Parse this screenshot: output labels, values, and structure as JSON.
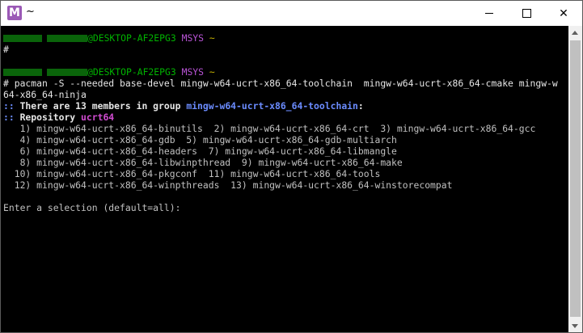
{
  "window": {
    "title": "~",
    "icon_letter": "M",
    "minimize_icon": "minimize-icon",
    "maximize_icon": "maximize-icon",
    "close_icon": "close-icon",
    "close_glyph": "✕"
  },
  "colors": {
    "prompt_green": "#00b300",
    "msys_purple": "#b954d6",
    "tilde_yellow": "#c8b400",
    "group_blue": "#6b8cff",
    "repo_magenta": "#d24cd2"
  },
  "terminal": {
    "prompt1": {
      "host": "@DESKTOP-AF2EPG3",
      "env": "MSYS",
      "dir": "~",
      "symbol": "#"
    },
    "prompt2": {
      "host": "@DESKTOP-AF2EPG3",
      "env": "MSYS",
      "dir": "~",
      "symbol": "#",
      "command": " pacman -S --needed base-devel mingw-w64-ucrt-x86_64-toolchain  mingw-w64-ucrt-x86_64-cmake mingw-w",
      "command_cont": "64-x86_64-ninja"
    },
    "group_line": {
      "prefix": ":: ",
      "text": "There are 13 members in group ",
      "group": "mingw-w64-ucrt-x86_64-toolchain",
      "suffix": ":"
    },
    "repo_line": {
      "prefix": ":: ",
      "text": "Repository ",
      "repo": "ucrt64"
    },
    "members": [
      "   1) mingw-w64-ucrt-x86_64-binutils  2) mingw-w64-ucrt-x86_64-crt  3) mingw-w64-ucrt-x86_64-gcc",
      "   4) mingw-w64-ucrt-x86_64-gdb  5) mingw-w64-ucrt-x86_64-gdb-multiarch",
      "   6) mingw-w64-ucrt-x86_64-headers  7) mingw-w64-ucrt-x86_64-libmangle",
      "   8) mingw-w64-ucrt-x86_64-libwinpthread  9) mingw-w64-ucrt-x86_64-make",
      "  10) mingw-w64-ucrt-x86_64-pkgconf  11) mingw-w64-ucrt-x86_64-tools",
      "  12) mingw-w64-ucrt-x86_64-winpthreads  13) mingw-w64-ucrt-x86_64-winstorecompat"
    ],
    "selection_prompt": "Enter a selection (default=all): "
  }
}
